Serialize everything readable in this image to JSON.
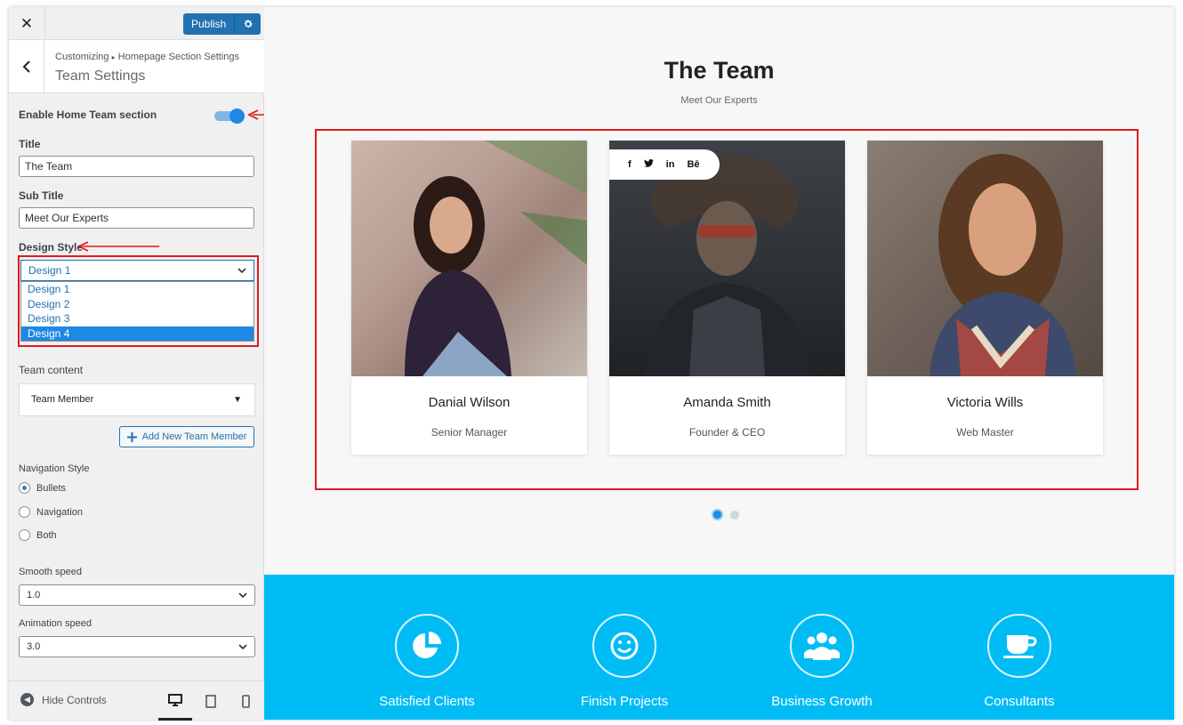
{
  "topbar": {
    "close_label": "✕",
    "publish_label": "Publish"
  },
  "header": {
    "breadcrumb_root": "Customizing",
    "breadcrumb_sep": "▸",
    "breadcrumb_section": "Homepage Section Settings",
    "title": "Team Settings"
  },
  "controls": {
    "enable_label": "Enable Home Team section",
    "enable_on": true,
    "title_label": "Title",
    "title_value": "The Team",
    "subtitle_label": "Sub Title",
    "subtitle_value": "Meet Our Experts",
    "design_label": "Design Style",
    "design_selected": "Design 1",
    "design_options": [
      "Design 1",
      "Design 2",
      "Design 3",
      "Design 4"
    ],
    "team_content_label": "Team content",
    "team_member_label": "Team Member",
    "add_member_label": "Add New Team Member",
    "nav_style_label": "Navigation Style",
    "nav_options": [
      "Bullets",
      "Navigation",
      "Both"
    ],
    "nav_selected": "Bullets",
    "smooth_label": "Smooth speed",
    "smooth_value": "1.0",
    "anim_label": "Animation speed",
    "anim_value": "3.0"
  },
  "footer": {
    "hide_controls": "Hide Controls"
  },
  "preview": {
    "title": "The Team",
    "subtitle": "Meet Our Experts",
    "members": [
      {
        "name": "Danial Wilson",
        "role": "Senior Manager"
      },
      {
        "name": "Amanda Smith",
        "role": "Founder & CEO"
      },
      {
        "name": "Victoria Wills",
        "role": "Web Master"
      }
    ],
    "social": {
      "facebook": "f",
      "twitter": "🐦",
      "linkedin": "in",
      "behance": "Bē"
    },
    "stats": [
      "Satisfied Clients",
      "Finish Projects",
      "Business Growth",
      "Consultants"
    ]
  },
  "colors": {
    "accent": "#2271b1",
    "highlight": "#e0191a",
    "stats_bg": "#00bcf5"
  }
}
